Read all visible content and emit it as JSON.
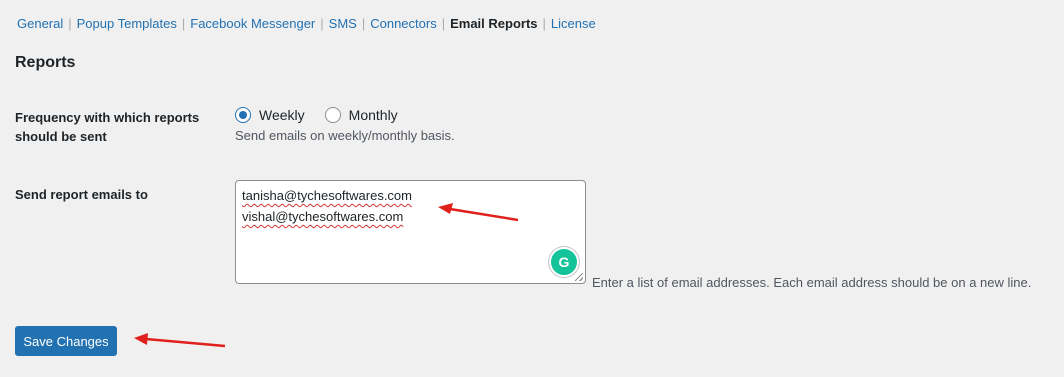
{
  "subnav": {
    "items": [
      "General",
      "Popup Templates",
      "Facebook Messenger",
      "SMS",
      "Connectors",
      "Email Reports",
      "License"
    ],
    "current": "Email Reports"
  },
  "reports": {
    "title": "Reports",
    "frequency_label": "Frequency with which reports should be sent",
    "options": [
      "Weekly",
      "Monthly"
    ],
    "selected": "Weekly",
    "frequency_description": "Send emails on weekly/monthly basis.",
    "emails_label": "Send report emails to",
    "emails": [
      "tanisha@tychesoftwares.com",
      "vishal@tychesoftwares.com"
    ],
    "emails_description": "Enter a list of email addresses. Each email address should be on a new line."
  },
  "save_button": "Save Changes",
  "colors": {
    "link": "#2271b1",
    "primary_button": "#2271b1",
    "annotation_arrow": "#e0201d",
    "grammarly": "#15c39a"
  }
}
